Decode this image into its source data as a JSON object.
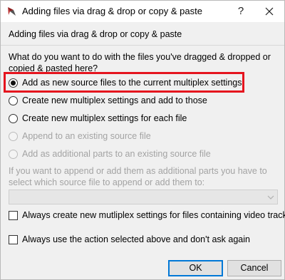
{
  "window": {
    "title": "Adding files via drag & drop or copy & paste",
    "help_glyph": "?",
    "close_icon": "close-icon",
    "app_icon": "mkvtoolnix-app-icon"
  },
  "header": {
    "text": "Adding files via drag & drop or copy & paste"
  },
  "question": "What do you want to do with the files you've dragged & dropped or copied & pasted here?",
  "options": [
    {
      "label": "Add as new source files to the current multiplex settings",
      "checked": true,
      "enabled": true
    },
    {
      "label": "Create new multiplex settings and add to those",
      "checked": false,
      "enabled": true
    },
    {
      "label": "Create new multiplex settings for each file",
      "checked": false,
      "enabled": true
    },
    {
      "label": "Append to an existing source file",
      "checked": false,
      "enabled": false
    },
    {
      "label": "Add as additional parts to an existing source file",
      "checked": false,
      "enabled": false
    }
  ],
  "append_info": "If you want to append or add them as additional parts you have to select which source file to append or add them to:",
  "source_file_select": {
    "value": "",
    "enabled": false
  },
  "checkboxes": [
    {
      "label": "Always create new mutliplex settings for files containing video tracks",
      "checked": false
    },
    {
      "label": "Always use the action selected above and don't ask again",
      "checked": false
    }
  ],
  "buttons": {
    "ok": "OK",
    "cancel": "Cancel"
  },
  "colors": {
    "highlight": "#e5141e",
    "default_button_border": "#0078d7",
    "disabled_text": "#a3a3a3"
  }
}
